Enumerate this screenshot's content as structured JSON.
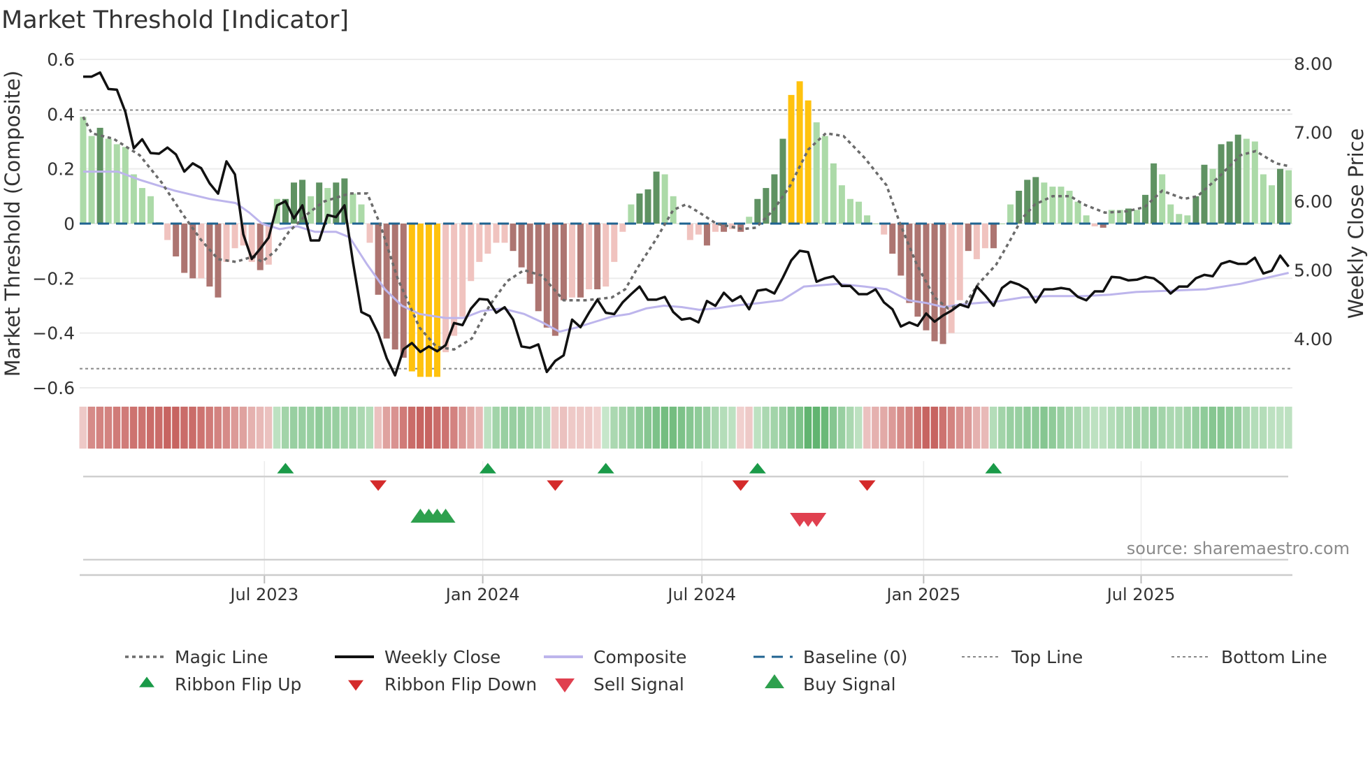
{
  "title": "Market Threshold [Indicator]",
  "source": "source: sharemaestro.com",
  "chart_data": {
    "type": "bar",
    "title": "Market Threshold [Indicator]",
    "ylabel": "Market Threshold (Composite)",
    "y2label": "Weekly Close Price",
    "ylim": [
      -0.63,
      0.63
    ],
    "y2lim": [
      3.4,
      8.06
    ],
    "yticks": [
      {
        "v": 0.6,
        "label": "0.6"
      },
      {
        "v": 0.4,
        "label": "0.4"
      },
      {
        "v": 0.2,
        "label": "0.2"
      },
      {
        "v": 0,
        "label": "0"
      },
      {
        "v": -0.2,
        "label": "−0.2"
      },
      {
        "v": -0.4,
        "label": "−0.4"
      },
      {
        "v": -0.6,
        "label": "−0.6"
      }
    ],
    "y2ticks": [
      {
        "v": 8,
        "label": "8.00"
      },
      {
        "v": 7,
        "label": "7.00"
      },
      {
        "v": 6,
        "label": "6.00"
      },
      {
        "v": 5,
        "label": "5.00"
      },
      {
        "v": 4,
        "label": "4.00"
      }
    ],
    "x_unit": "week index",
    "xlim": [
      0,
      143
    ],
    "xticks": [
      {
        "w": 21.5,
        "label": "Jul 2023"
      },
      {
        "w": 47.4,
        "label": "Jan 2024"
      },
      {
        "w": 73.4,
        "label": "Jul 2024"
      },
      {
        "w": 99.7,
        "label": "Jan 2025"
      },
      {
        "w": 125.5,
        "label": "Jul 2025"
      }
    ],
    "top_line": 0.415,
    "bottom_line": -0.53,
    "baseline": 0,
    "composite_bars": {
      "values": [
        0.39,
        0.32,
        0.35,
        0.31,
        0.29,
        0.28,
        0.18,
        0.13,
        0.1,
        0.005,
        -0.06,
        -0.12,
        -0.18,
        -0.2,
        -0.2,
        -0.23,
        -0.27,
        -0.14,
        -0.09,
        -0.08,
        -0.14,
        -0.17,
        -0.15,
        0.09,
        0.09,
        0.15,
        0.16,
        0.1,
        0.15,
        0.13,
        0.15,
        0.165,
        0.11,
        0.07,
        -0.07,
        -0.26,
        -0.42,
        -0.46,
        -0.49,
        -0.54,
        -0.56,
        -0.56,
        -0.56,
        -0.47,
        -0.41,
        -0.34,
        -0.21,
        -0.14,
        -0.11,
        -0.07,
        -0.07,
        -0.1,
        -0.16,
        -0.22,
        -0.32,
        -0.38,
        -0.41,
        -0.28,
        -0.27,
        -0.27,
        -0.24,
        -0.24,
        -0.23,
        -0.14,
        -0.03,
        0.07,
        0.11,
        0.125,
        0.19,
        0.18,
        0.1,
        0.0,
        -0.06,
        -0.04,
        -0.08,
        -0.03,
        -0.03,
        -0.02,
        -0.03,
        0.025,
        0.09,
        0.13,
        0.18,
        0.31,
        0.47,
        0.52,
        0.45,
        0.37,
        0.32,
        0.22,
        0.14,
        0.09,
        0.08,
        0.03,
        0.0,
        -0.04,
        -0.11,
        -0.19,
        -0.29,
        -0.34,
        -0.39,
        -0.43,
        -0.44,
        -0.4,
        -0.28,
        -0.1,
        -0.13,
        -0.09,
        -0.09,
        0.0,
        0.07,
        0.12,
        0.16,
        0.17,
        0.15,
        0.135,
        0.135,
        0.12,
        0.08,
        0.03,
        -0.01,
        -0.015,
        0.05,
        0.05,
        0.055,
        0.05,
        0.105,
        0.22,
        0.18,
        0.07,
        0.035,
        0.03,
        0.1,
        0.215,
        0.2,
        0.29,
        0.3,
        0.325,
        0.31,
        0.3,
        0.18,
        0.14,
        0.2,
        0.195
      ],
      "shade": [
        "lg",
        "lg",
        "dg",
        "lg",
        "lg",
        "lg",
        "lg",
        "lg",
        "lg",
        "lg",
        "lr",
        "dr",
        "dr",
        "dr",
        "lr",
        "dr",
        "dr",
        "lr",
        "lr",
        "lr",
        "lr",
        "dr",
        "lr",
        "lg",
        "dg",
        "dg",
        "dg",
        "lg",
        "dg",
        "lg",
        "dg",
        "dg",
        "lg",
        "lg",
        "lr",
        "dr",
        "dr",
        "dr",
        "dr",
        "y",
        "y",
        "y",
        "y",
        "lr",
        "lr",
        "lr",
        "lr",
        "lr",
        "lr",
        "lr",
        "lr",
        "dr",
        "dr",
        "dr",
        "dr",
        "dr",
        "dr",
        "dr",
        "lr",
        "dr",
        "lr",
        "dr",
        "lr",
        "lr",
        "lr",
        "lg",
        "dg",
        "dg",
        "dg",
        "lg",
        "lg",
        "lg",
        "lr",
        "lr",
        "dr",
        "lr",
        "dr",
        "lr",
        "dr",
        "lg",
        "dg",
        "dg",
        "dg",
        "dg",
        "y",
        "y",
        "y",
        "lg",
        "lg",
        "lg",
        "lg",
        "lg",
        "lg",
        "lg",
        "lg",
        "lr",
        "dr",
        "dr",
        "dr",
        "dr",
        "dr",
        "dr",
        "dr",
        "lr",
        "lr",
        "dr",
        "lr",
        "lr",
        "dr",
        "lg",
        "lg",
        "dg",
        "dg",
        "dg",
        "lg",
        "lg",
        "lg",
        "lg",
        "lg",
        "lg",
        "lr",
        "dr",
        "lg",
        "lg",
        "dg",
        "lg",
        "dg",
        "dg",
        "lg",
        "lg",
        "lg",
        "lg",
        "dg",
        "dg",
        "lg",
        "dg",
        "dg",
        "dg",
        "lg",
        "lg",
        "lg",
        "lg",
        "dg",
        "lg"
      ]
    },
    "weekly_close": [
      7.81,
      7.81,
      7.87,
      7.63,
      7.62,
      7.3,
      6.77,
      6.9,
      6.7,
      6.69,
      6.78,
      6.68,
      6.43,
      6.55,
      6.48,
      6.26,
      6.11,
      6.58,
      6.39,
      5.52,
      5.16,
      5.31,
      5.47,
      5.94,
      6.0,
      5.75,
      5.94,
      5.43,
      5.43,
      5.8,
      5.77,
      5.94,
      5.12,
      4.39,
      4.33,
      4.08,
      3.72,
      3.47,
      3.85,
      3.94,
      3.81,
      3.89,
      3.82,
      3.91,
      4.23,
      4.2,
      4.44,
      4.58,
      4.57,
      4.38,
      4.46,
      4.28,
      3.89,
      3.87,
      3.92,
      3.52,
      3.68,
      3.76,
      4.28,
      4.17,
      4.38,
      4.57,
      4.38,
      4.36,
      4.53,
      4.65,
      4.76,
      4.57,
      4.57,
      4.61,
      4.39,
      4.28,
      4.3,
      4.24,
      4.55,
      4.48,
      4.67,
      4.55,
      4.62,
      4.43,
      4.7,
      4.72,
      4.66,
      4.89,
      5.14,
      5.28,
      5.26,
      4.83,
      4.88,
      4.91,
      4.77,
      4.77,
      4.65,
      4.65,
      4.72,
      4.53,
      4.43,
      4.18,
      4.24,
      4.19,
      4.37,
      4.25,
      4.34,
      4.41,
      4.5,
      4.46,
      4.76,
      4.63,
      4.48,
      4.74,
      4.83,
      4.79,
      4.72,
      4.53,
      4.72,
      4.72,
      4.74,
      4.72,
      4.61,
      4.56,
      4.69,
      4.69,
      4.9,
      4.89,
      4.85,
      4.86,
      4.9,
      4.88,
      4.79,
      4.66,
      4.76,
      4.76,
      4.88,
      4.93,
      4.91,
      5.09,
      5.13,
      5.09,
      5.09,
      5.18,
      4.95,
      4.99,
      5.21,
      5.05
    ],
    "composite_line": [
      [
        0,
        0.19
      ],
      [
        4.1,
        0.19
      ],
      [
        6.7,
        0.16
      ],
      [
        10.9,
        0.12
      ],
      [
        15,
        0.09
      ],
      [
        18.1,
        0.075
      ],
      [
        19.7,
        0.04
      ],
      [
        21.2,
        0.0
      ],
      [
        23.3,
        -0.02
      ],
      [
        25.4,
        -0.01
      ],
      [
        27.5,
        -0.03
      ],
      [
        30,
        -0.03
      ],
      [
        31.6,
        -0.05
      ],
      [
        33.7,
        -0.15
      ],
      [
        35.8,
        -0.24
      ],
      [
        37.8,
        -0.3
      ],
      [
        39.9,
        -0.33
      ],
      [
        43,
        -0.345
      ],
      [
        45.1,
        -0.345
      ],
      [
        47.2,
        -0.32
      ],
      [
        49.7,
        -0.31
      ],
      [
        52.3,
        -0.33
      ],
      [
        54.4,
        -0.36
      ],
      [
        56.5,
        -0.395
      ],
      [
        58.5,
        -0.38
      ],
      [
        60.6,
        -0.36
      ],
      [
        62.7,
        -0.34
      ],
      [
        64.8,
        -0.33
      ],
      [
        66.8,
        -0.31
      ],
      [
        68.9,
        -0.3
      ],
      [
        71,
        -0.305
      ],
      [
        73.1,
        -0.315
      ],
      [
        75.1,
        -0.31
      ],
      [
        77.2,
        -0.3
      ],
      [
        80.3,
        -0.29
      ],
      [
        82.9,
        -0.28
      ],
      [
        85.5,
        -0.23
      ],
      [
        89.6,
        -0.22
      ],
      [
        92.7,
        -0.23
      ],
      [
        95.3,
        -0.24
      ],
      [
        97.9,
        -0.28
      ],
      [
        100,
        -0.29
      ],
      [
        102.1,
        -0.305
      ],
      [
        104.1,
        -0.295
      ],
      [
        108.3,
        -0.285
      ],
      [
        111.4,
        -0.27
      ],
      [
        114.5,
        -0.265
      ],
      [
        118.7,
        -0.265
      ],
      [
        121.8,
        -0.26
      ],
      [
        124.9,
        -0.25
      ],
      [
        129,
        -0.245
      ],
      [
        133.2,
        -0.24
      ],
      [
        137.3,
        -0.22
      ],
      [
        143,
        -0.18
      ]
    ],
    "magic_line": [
      [
        0,
        0.39
      ],
      [
        1,
        0.33
      ],
      [
        3.6,
        0.31
      ],
      [
        6.7,
        0.25
      ],
      [
        9.3,
        0.15
      ],
      [
        11.9,
        0.03
      ],
      [
        14,
        -0.06
      ],
      [
        16,
        -0.13
      ],
      [
        18.1,
        -0.14
      ],
      [
        20.2,
        -0.12
      ],
      [
        21.2,
        -0.14
      ],
      [
        22.8,
        -0.1
      ],
      [
        24.4,
        -0.03
      ],
      [
        26.4,
        0.03
      ],
      [
        28.5,
        0.08
      ],
      [
        31.6,
        0.11
      ],
      [
        33.7,
        0.11
      ],
      [
        35.2,
        0.0
      ],
      [
        37.3,
        -0.2
      ],
      [
        39.9,
        -0.38
      ],
      [
        41.9,
        -0.45
      ],
      [
        44,
        -0.46
      ],
      [
        46.1,
        -0.42
      ],
      [
        48.2,
        -0.3
      ],
      [
        50.3,
        -0.21
      ],
      [
        52.3,
        -0.17
      ],
      [
        54.4,
        -0.19
      ],
      [
        57,
        -0.28
      ],
      [
        59.6,
        -0.28
      ],
      [
        62.7,
        -0.27
      ],
      [
        64.3,
        -0.24
      ],
      [
        65.8,
        -0.16
      ],
      [
        67.9,
        -0.06
      ],
      [
        70,
        0.05
      ],
      [
        71.5,
        0.07
      ],
      [
        73.1,
        0.04
      ],
      [
        75.1,
        0.0
      ],
      [
        78.2,
        -0.02
      ],
      [
        79.8,
        -0.015
      ],
      [
        81.9,
        0.05
      ],
      [
        83.9,
        0.14
      ],
      [
        86,
        0.27
      ],
      [
        88.1,
        0.33
      ],
      [
        90.2,
        0.32
      ],
      [
        92.7,
        0.24
      ],
      [
        95.3,
        0.14
      ],
      [
        96.9,
        0.0
      ],
      [
        98.9,
        -0.15
      ],
      [
        101,
        -0.27
      ],
      [
        102.6,
        -0.31
      ],
      [
        104.7,
        -0.29
      ],
      [
        106.2,
        -0.22
      ],
      [
        108.3,
        -0.15
      ],
      [
        109.8,
        -0.07
      ],
      [
        111.4,
        0.02
      ],
      [
        112.9,
        0.07
      ],
      [
        115,
        0.1
      ],
      [
        117.1,
        0.1
      ],
      [
        118.7,
        0.07
      ],
      [
        121.2,
        0.04
      ],
      [
        123.8,
        0.045
      ],
      [
        125.9,
        0.06
      ],
      [
        128,
        0.12
      ],
      [
        130.6,
        0.09
      ],
      [
        132.2,
        0.1
      ],
      [
        134.7,
        0.17
      ],
      [
        137.3,
        0.25
      ],
      [
        139.1,
        0.265
      ],
      [
        141.5,
        0.22
      ],
      [
        143,
        0.21
      ]
    ],
    "ribbon": [
      -0.15,
      -0.55,
      -0.6,
      -0.6,
      -0.65,
      -0.65,
      -0.7,
      -0.7,
      -0.75,
      -0.75,
      -0.8,
      -0.8,
      -0.75,
      -0.75,
      -0.7,
      -0.65,
      -0.6,
      -0.55,
      -0.45,
      -0.4,
      -0.3,
      -0.25,
      -0.2,
      0.2,
      0.35,
      0.4,
      0.4,
      0.4,
      0.45,
      0.4,
      0.4,
      0.35,
      0.35,
      0.3,
      0.25,
      -0.2,
      -0.4,
      -0.5,
      -0.65,
      -0.75,
      -0.8,
      -0.8,
      -0.75,
      -0.7,
      -0.6,
      -0.45,
      -0.35,
      -0.25,
      0.2,
      0.35,
      0.4,
      0.4,
      0.4,
      0.35,
      0.3,
      0.25,
      -0.15,
      -0.2,
      -0.15,
      -0.15,
      -0.15,
      -0.1,
      0.15,
      0.3,
      0.35,
      0.4,
      0.45,
      0.5,
      0.55,
      0.6,
      0.6,
      0.55,
      0.5,
      0.45,
      0.4,
      0.3,
      0.25,
      0.2,
      -0.1,
      -0.15,
      0.2,
      0.3,
      0.35,
      0.4,
      0.5,
      0.55,
      0.7,
      0.7,
      0.65,
      0.5,
      0.4,
      0.3,
      0.2,
      -0.2,
      -0.3,
      -0.35,
      -0.45,
      -0.55,
      -0.6,
      -0.7,
      -0.8,
      -0.8,
      -0.7,
      -0.6,
      -0.5,
      -0.45,
      -0.3,
      -0.25,
      0.25,
      0.35,
      0.4,
      0.4,
      0.45,
      0.45,
      0.5,
      0.45,
      0.4,
      0.35,
      0.3,
      0.25,
      0.2,
      0.2,
      0.25,
      0.3,
      0.3,
      0.35,
      0.35,
      0.4,
      0.35,
      0.3,
      0.3,
      0.35,
      0.4,
      0.45,
      0.5,
      0.5,
      0.45,
      0.4,
      0.3,
      0.25,
      0.25,
      0.2,
      0.2,
      0.2
    ],
    "ribbon_flip_up": [
      24,
      48,
      62,
      80,
      108
    ],
    "ribbon_flip_down": [
      35,
      56,
      78,
      93
    ],
    "buy_signals": [
      40,
      41,
      42,
      43
    ],
    "sell_signals": [
      85,
      86,
      87
    ],
    "legend": [
      {
        "label": "Magic Line",
        "kind": "dotted"
      },
      {
        "label": "Weekly Close",
        "kind": "solid"
      },
      {
        "label": "Composite",
        "kind": "lavender"
      },
      {
        "label": "Baseline (0)",
        "kind": "dashed"
      },
      {
        "label": "Top Line",
        "kind": "thin-dotted"
      },
      {
        "label": "Bottom Line",
        "kind": "thin-dotted"
      },
      {
        "label": "Ribbon Flip Up",
        "kind": "flip-up"
      },
      {
        "label": "Ribbon Flip Down",
        "kind": "flip-down"
      },
      {
        "label": "Sell Signal",
        "kind": "sell"
      },
      {
        "label": "Buy Signal",
        "kind": "buy"
      }
    ],
    "legend_placement": "bottom"
  },
  "colors": {
    "lg": "#acdaa8",
    "dg": "#5f9262",
    "lr": "#f0c3bf",
    "dr": "#ad7571",
    "y": "#ffc20e",
    "close": "#111111",
    "composite": "#bdb5ec",
    "magic": "#6b6b6b",
    "baseline": "#1f6390",
    "guide": "#888888",
    "grid": "#ececec",
    "flip_up": "#1a9a48",
    "flip_down": "#d42a2a",
    "buy": "#2ea04e",
    "sell": "#e0404f"
  }
}
